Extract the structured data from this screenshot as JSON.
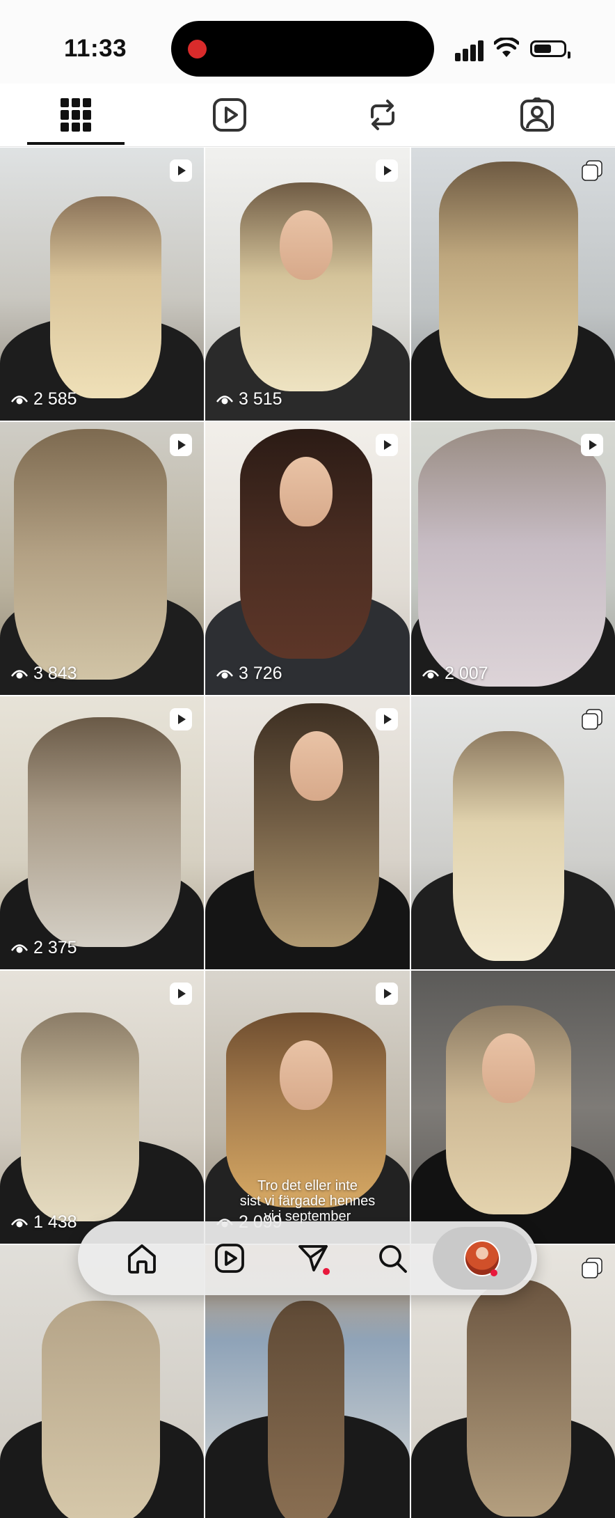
{
  "status_bar": {
    "time": "11:33",
    "icons": [
      "signal-icon",
      "wifi-icon",
      "battery-icon"
    ],
    "recording_indicator_color": "#d92b2b"
  },
  "profile_tabs": [
    {
      "name": "grid-tab",
      "icon": "grid-icon",
      "active": true
    },
    {
      "name": "reels-tab",
      "icon": "reels-icon",
      "active": false
    },
    {
      "name": "reposts-tab",
      "icon": "repost-icon",
      "active": false
    },
    {
      "name": "tagged-tab",
      "icon": "tagged-person-icon",
      "active": false
    }
  ],
  "posts": [
    {
      "type": "reel",
      "views": "2 585"
    },
    {
      "type": "reel",
      "views": "3 515"
    },
    {
      "type": "carousel",
      "views": ""
    },
    {
      "type": "reel",
      "views": "3 843"
    },
    {
      "type": "reel",
      "views": "3 726"
    },
    {
      "type": "reel",
      "views": "2 007"
    },
    {
      "type": "reel",
      "views": "2 375"
    },
    {
      "type": "reel",
      "views": ""
    },
    {
      "type": "carousel",
      "views": ""
    },
    {
      "type": "reel",
      "views": "1 438"
    },
    {
      "type": "reel",
      "views": "2 099",
      "caption": "Tro det eller inte\nsist vi färgade hennes\nvi i september"
    },
    {
      "type": "photo",
      "views": ""
    },
    {
      "type": "photo",
      "views": ""
    },
    {
      "type": "photo",
      "views": ""
    },
    {
      "type": "carousel",
      "views": ""
    }
  ],
  "bottom_nav": {
    "items": [
      {
        "name": "home",
        "icon": "home-icon",
        "notification_dot": false
      },
      {
        "name": "reels",
        "icon": "reels-icon",
        "notification_dot": false
      },
      {
        "name": "messages",
        "icon": "send-icon",
        "notification_dot": true
      },
      {
        "name": "search",
        "icon": "search-icon",
        "notification_dot": false
      },
      {
        "name": "profile",
        "icon": "avatar",
        "notification_dot": true,
        "active": true
      }
    ],
    "notification_color": "#e8183c"
  }
}
